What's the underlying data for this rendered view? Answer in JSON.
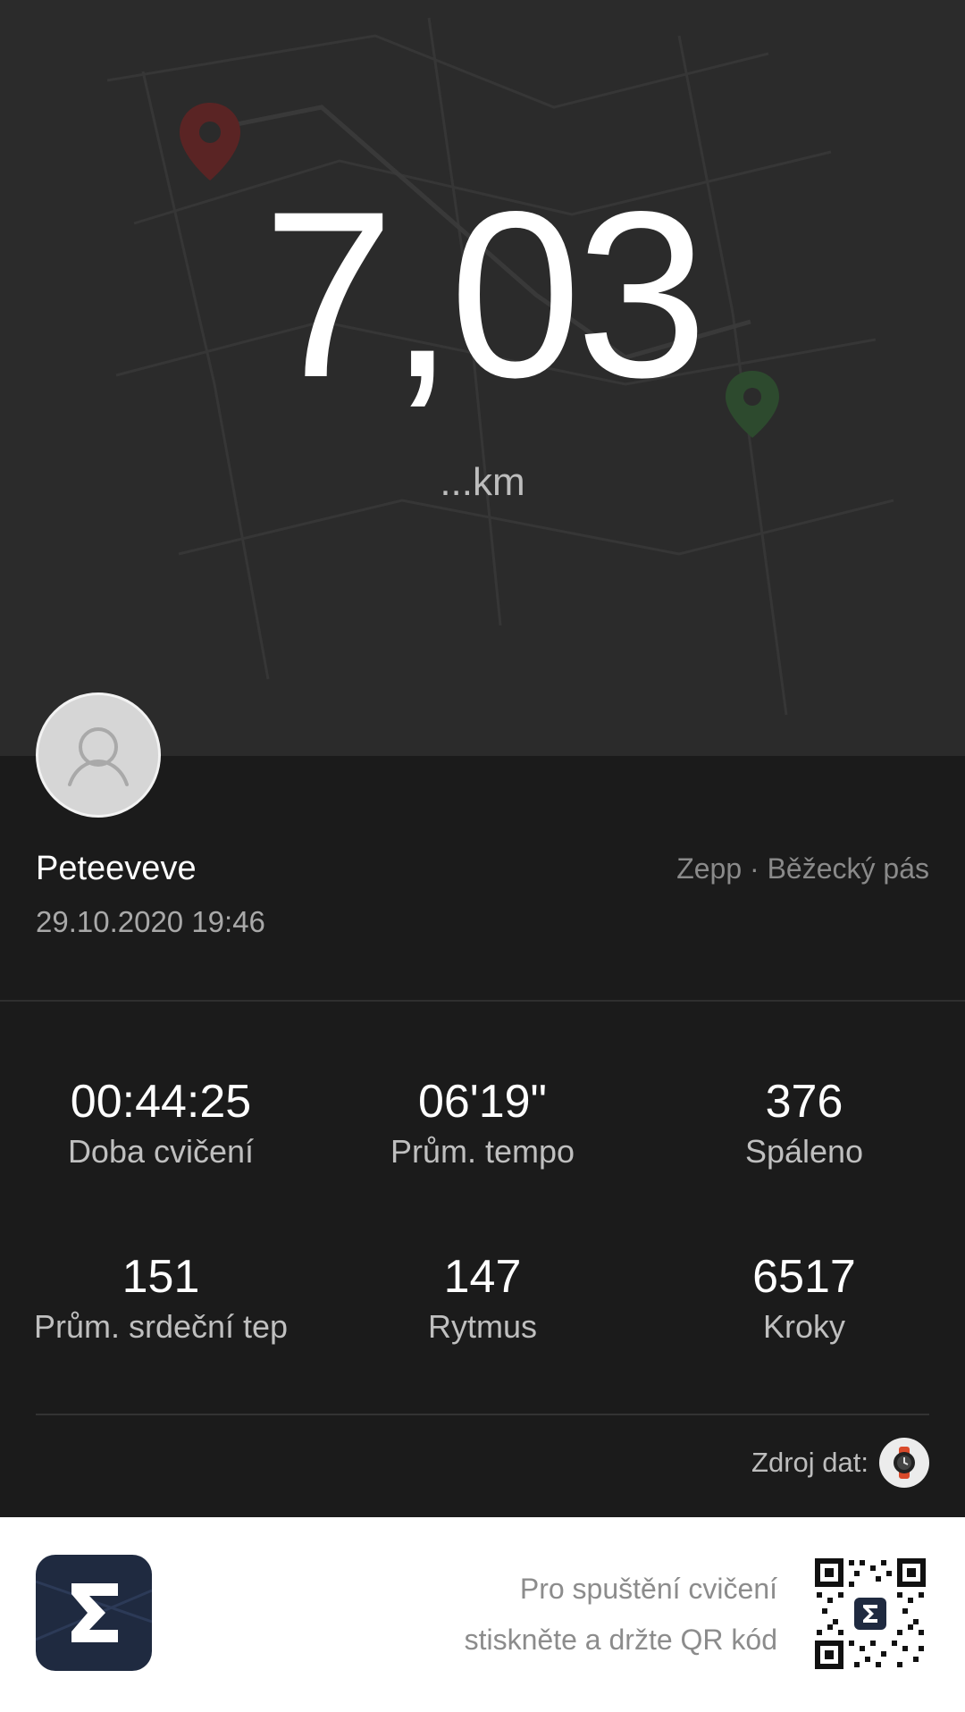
{
  "hero": {
    "distance": "7,03",
    "unit": "...km",
    "map_pins": [
      "start-pin",
      "end-pin"
    ]
  },
  "profile": {
    "name": "Peteeveve",
    "datetime": "29.10.2020 19:46",
    "source": "Zepp · Běžecký pás"
  },
  "stats": [
    {
      "value": "00:44:25",
      "label": "Doba cvičení"
    },
    {
      "value": "06'19\"",
      "label": "Prům. tempo"
    },
    {
      "value": "376",
      "label": "Spáleno"
    },
    {
      "value": "151",
      "label": "Prům. srdeční tep"
    },
    {
      "value": "147",
      "label": "Rytmus"
    },
    {
      "value": "6517",
      "label": "Kroky"
    }
  ],
  "data_source": {
    "label": "Zdroj dat:",
    "icon": "watch-icon"
  },
  "footer": {
    "app_icon": "zepp-sigma-icon",
    "qr_line1": "Pro spuštění cvičení",
    "qr_line2": "stiskněte a držte QR kód",
    "qr_icon": "qr-code"
  },
  "colors": {
    "hero_bg": "#2b2b2b",
    "panel_bg": "#1b1b1b",
    "start_pin": "#c0392b",
    "end_pin": "#3fae49",
    "app_icon_bg": "#1f2a40"
  }
}
